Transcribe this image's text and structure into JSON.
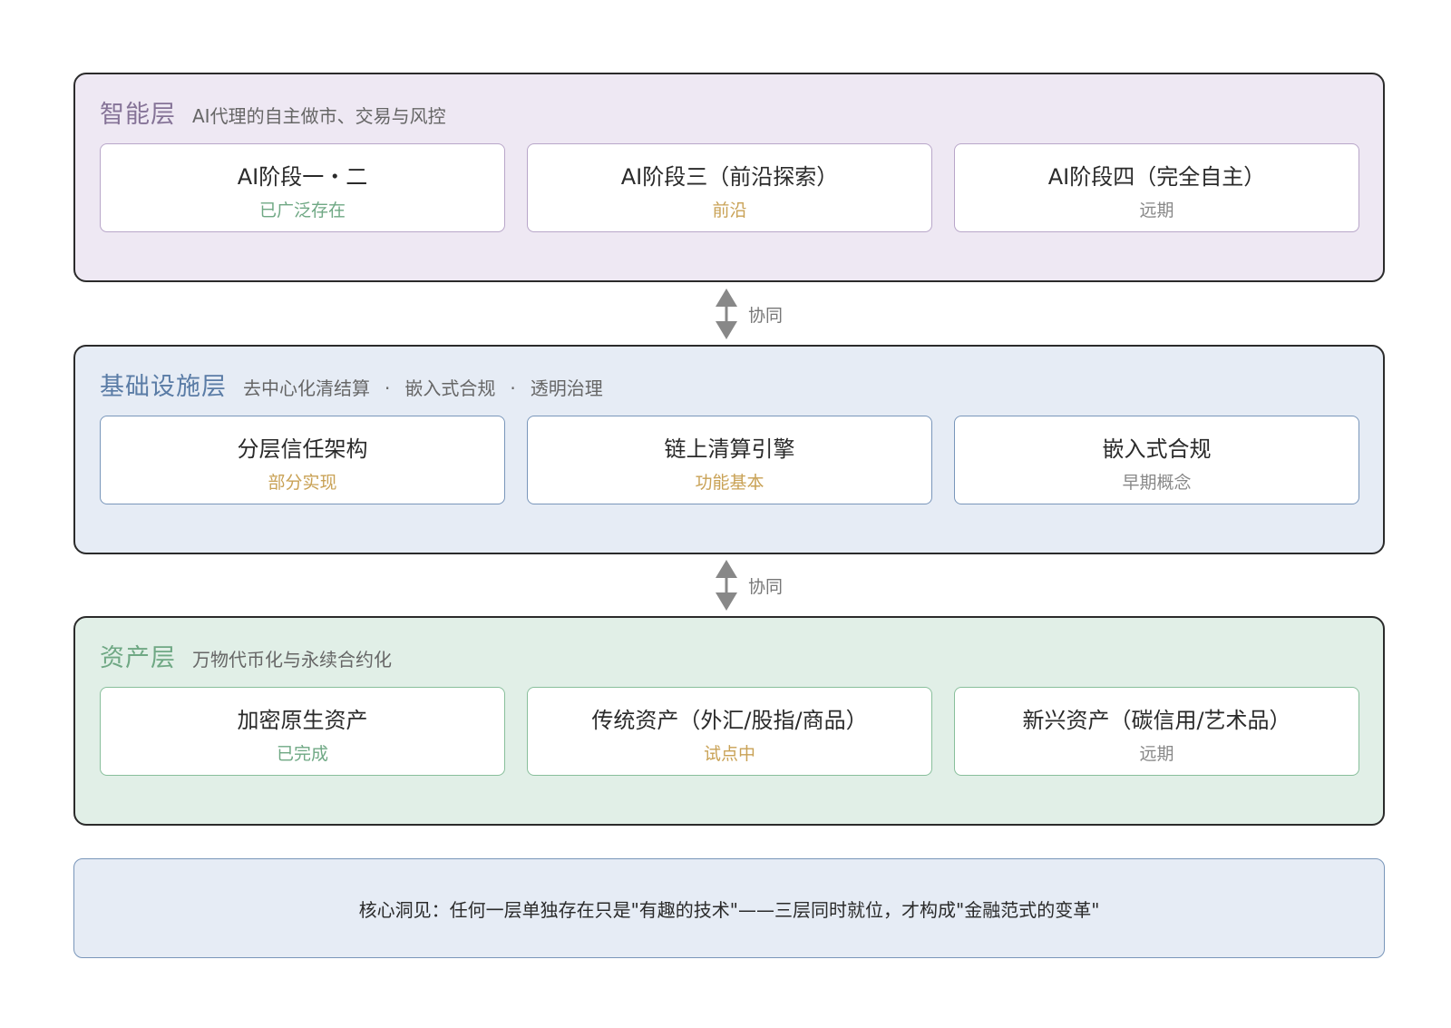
{
  "colors": {
    "ai_layer_bg": "#eee8f3",
    "infra_layer_bg": "#e6ecf5",
    "asset_layer_bg": "#e1efe7",
    "status_done": "#6fa884",
    "status_progress": "#c9a256",
    "status_future": "#888888"
  },
  "layers": [
    {
      "title": "智能层",
      "subtitle_parts": [
        "AI代理的自主做市、交易与风控"
      ],
      "cards": [
        {
          "title": "AI阶段一・二",
          "status": "已广泛存在",
          "status_color": "#6fa884"
        },
        {
          "title": "AI阶段三（前沿探索）",
          "status": "前沿",
          "status_color": "#c9a256"
        },
        {
          "title": "AI阶段四（完全自主）",
          "status": "远期",
          "status_color": "#888888"
        }
      ]
    },
    {
      "title": "基础设施层",
      "subtitle_parts": [
        "去中心化清结算",
        "嵌入式合规",
        "透明治理"
      ],
      "separator": "·",
      "cards": [
        {
          "title": "分层信任架构",
          "status": "部分实现",
          "status_color": "#c9a256"
        },
        {
          "title": "链上清算引擎",
          "status": "功能基本",
          "status_color": "#c9a256"
        },
        {
          "title": "嵌入式合规",
          "status": "早期概念",
          "status_color": "#888888"
        }
      ]
    },
    {
      "title": "资产层",
      "subtitle_parts": [
        "万物代币化与永续合约化"
      ],
      "cards": [
        {
          "title": "加密原生资产",
          "status": "已完成",
          "status_color": "#6fa884"
        },
        {
          "title": "传统资产（外汇/股指/商品）",
          "status": "试点中",
          "status_color": "#c9a256"
        },
        {
          "title": "新兴资产（碳信用/艺术品）",
          "status": "远期",
          "status_color": "#888888"
        }
      ]
    }
  ],
  "connectors": [
    {
      "label": "协同",
      "icon": "double-arrow-icon"
    },
    {
      "label": "协同",
      "icon": "double-arrow-icon"
    }
  ],
  "insight": {
    "text": "核心洞见：任何一层单独存在只是\"有趣的技术\"——三层同时就位，才构成\"金融范式的变革\""
  }
}
